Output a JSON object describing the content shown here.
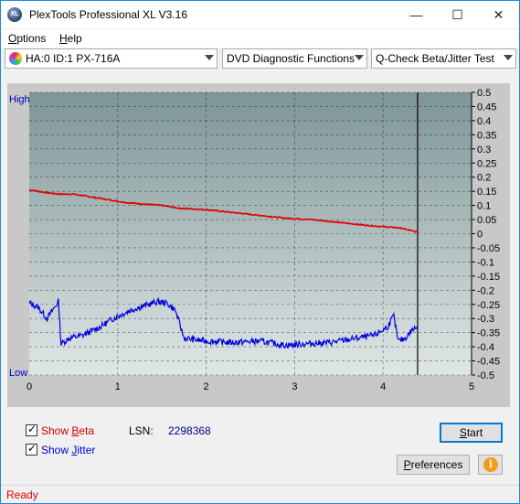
{
  "window": {
    "title": "PlexTools Professional XL V3.16",
    "icon_text": "XL",
    "icon": "app-logo-icon"
  },
  "window_controls": {
    "minimize": "—",
    "maximize": "☐",
    "close": "✕"
  },
  "menu": [
    {
      "label": "Options",
      "accel": "O",
      "rest": "ptions"
    },
    {
      "label": "Help",
      "accel": "H",
      "rest": "elp"
    }
  ],
  "toolbar": {
    "drive": "HA:0 ID:1  PX-716A",
    "function": "DVD Diagnostic Functions",
    "test": "Q-Check Beta/Jitter Test"
  },
  "chart_data": {
    "type": "line",
    "y_left_labels": {
      "high": "High",
      "low": "Low"
    },
    "x_ticks": [
      "0",
      "1",
      "2",
      "3",
      "4",
      "5"
    ],
    "xlim": [
      0,
      5
    ],
    "y_ticks": [
      "0.5",
      "0.45",
      "0.4",
      "0.35",
      "0.3",
      "0.25",
      "0.2",
      "0.15",
      "0.1",
      "0.05",
      "0",
      "-0.05",
      "-0.1",
      "-0.15",
      "-0.2",
      "-0.25",
      "-0.3",
      "-0.35",
      "-0.4",
      "-0.45",
      "-0.5"
    ],
    "ylim": [
      -0.5,
      0.5
    ],
    "end_marker_x": 4.39,
    "colors": {
      "beta": "#e00000",
      "jitter": "#0000e0",
      "plot_bg_top": "#7d9596",
      "plot_bg_bottom": "#e0e6e6"
    },
    "series": [
      {
        "name": "Beta",
        "points": [
          [
            0,
            0.155
          ],
          [
            0.2,
            0.145
          ],
          [
            0.35,
            0.14
          ],
          [
            0.5,
            0.14
          ],
          [
            0.7,
            0.13
          ],
          [
            0.9,
            0.12
          ],
          [
            1.1,
            0.11
          ],
          [
            1.3,
            0.105
          ],
          [
            1.5,
            0.1
          ],
          [
            1.7,
            0.09
          ],
          [
            2.0,
            0.085
          ],
          [
            2.3,
            0.075
          ],
          [
            2.6,
            0.065
          ],
          [
            2.9,
            0.055
          ],
          [
            3.2,
            0.05
          ],
          [
            3.5,
            0.04
          ],
          [
            3.8,
            0.03
          ],
          [
            4.0,
            0.025
          ],
          [
            4.2,
            0.02
          ],
          [
            4.39,
            0.005
          ]
        ]
      },
      {
        "name": "Jitter",
        "points": [
          [
            0,
            -0.245
          ],
          [
            0.1,
            -0.26
          ],
          [
            0.2,
            -0.3
          ],
          [
            0.3,
            -0.255
          ],
          [
            0.33,
            -0.24
          ],
          [
            0.36,
            -0.39
          ],
          [
            0.45,
            -0.37
          ],
          [
            0.6,
            -0.36
          ],
          [
            0.8,
            -0.33
          ],
          [
            0.95,
            -0.3
          ],
          [
            1.05,
            -0.285
          ],
          [
            1.15,
            -0.27
          ],
          [
            1.3,
            -0.255
          ],
          [
            1.45,
            -0.24
          ],
          [
            1.55,
            -0.245
          ],
          [
            1.65,
            -0.27
          ],
          [
            1.75,
            -0.37
          ],
          [
            2.0,
            -0.38
          ],
          [
            2.3,
            -0.385
          ],
          [
            2.6,
            -0.38
          ],
          [
            2.9,
            -0.395
          ],
          [
            3.1,
            -0.39
          ],
          [
            3.4,
            -0.385
          ],
          [
            3.7,
            -0.37
          ],
          [
            3.9,
            -0.36
          ],
          [
            4.05,
            -0.33
          ],
          [
            4.12,
            -0.29
          ],
          [
            4.17,
            -0.38
          ],
          [
            4.25,
            -0.37
          ],
          [
            4.33,
            -0.34
          ],
          [
            4.39,
            -0.33
          ]
        ]
      }
    ]
  },
  "options": {
    "show_beta": {
      "checked": true,
      "label_pre": "Show ",
      "accel": "B",
      "label_post": "eta",
      "color": "#d00000"
    },
    "show_jitter": {
      "checked": true,
      "label_pre": "Show ",
      "accel": "J",
      "label_post": "itter",
      "color": "#0000d0"
    },
    "lsn_label": "LSN:",
    "lsn_value": "2298368",
    "check_glyph": "✓"
  },
  "buttons": {
    "start_accel": "S",
    "start_rest": "tart",
    "prefs_accel": "P",
    "prefs_rest": "references",
    "info_glyph": "i"
  },
  "status": {
    "text": "Ready"
  }
}
